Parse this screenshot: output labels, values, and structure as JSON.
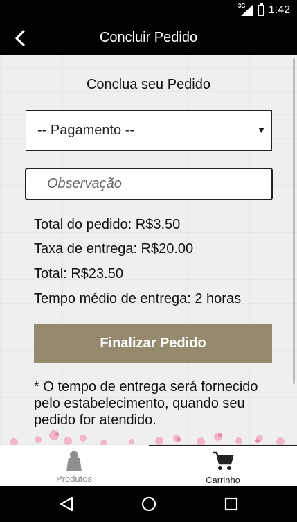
{
  "status_bar": {
    "network": "3G",
    "time": "1:42"
  },
  "app_bar": {
    "title": "Concluir Pedido"
  },
  "page": {
    "heading": "Conclua seu Pedido"
  },
  "payment_select": {
    "selected": "-- Pagamento --"
  },
  "observation": {
    "placeholder": "Observação"
  },
  "summary": {
    "order_total": "Total do pedido: R$3.50",
    "delivery_fee": "Taxa de entrega: R$20.00",
    "total": "Total: R$23.50",
    "avg_time": "Tempo médio de entrega: 2 horas"
  },
  "finalize_button": {
    "label": "Finalizar Pedido"
  },
  "note": "* O tempo de entrega será fornecido pelo estabelecimento, quando seu pedido for atendido.",
  "bottom_nav": {
    "tabs": [
      {
        "label": "Produtos",
        "icon": "flower-bag-icon",
        "active": false
      },
      {
        "label": "Carrinho",
        "icon": "cart-icon",
        "active": true
      }
    ]
  },
  "colors": {
    "accent_button": "#958a6e",
    "bars": "#000000"
  }
}
